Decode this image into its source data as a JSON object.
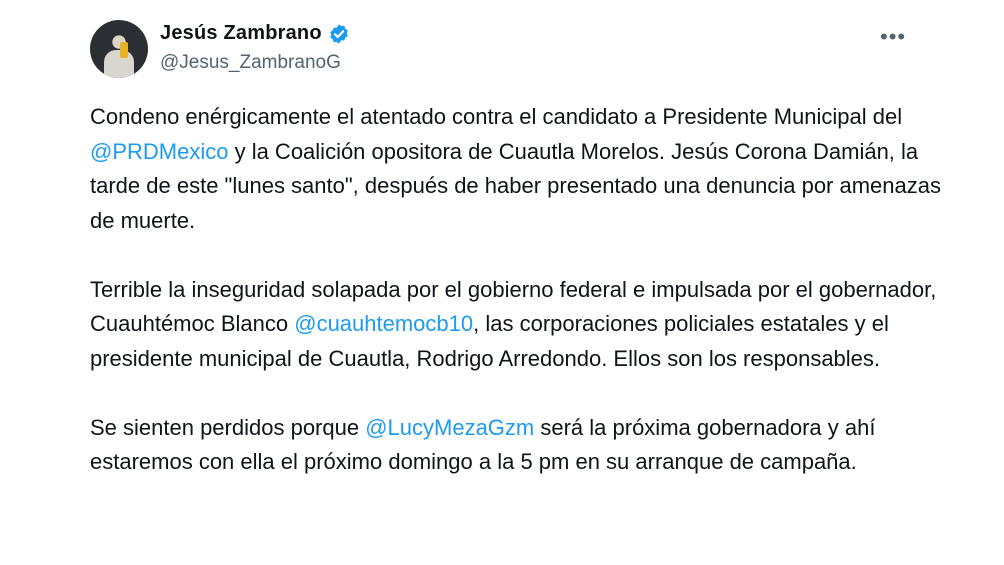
{
  "author": {
    "display_name": "Jesús Zambrano",
    "handle": "@Jesus_ZambranoG",
    "verified": true,
    "verified_color": "#1d9bf0"
  },
  "menu_icon": "more-horizontal-icon",
  "colors": {
    "text": "#0f1419",
    "secondary": "#536471",
    "mention": "#1d9bf0"
  },
  "tweet": {
    "p1": {
      "t1": "Condeno enérgicamente el atentado contra el candidato a Presidente Municipal del ",
      "m1": "@PRDMexico",
      "t2": " y la Coalición opositora de Cuautla Morelos. Jesús Corona Damián, la tarde de este \"lunes santo\", después de haber presentado una denuncia por amenazas de muerte."
    },
    "p2": {
      "t1": "Terrible la inseguridad solapada por el gobierno federal e impulsada por el gobernador, Cuauhtémoc Blanco ",
      "m1": "@cuauhtemocb10",
      "t2": ", las corporaciones policiales estatales y el presidente municipal de Cuautla, Rodrigo Arredondo. Ellos son los responsables."
    },
    "p3": {
      "t1": "Se sienten perdidos porque ",
      "m1": "@LucyMezaGzm",
      "t2": " será la próxima gobernadora y ahí estaremos con ella el próximo domingo a la 5 pm en su arranque de campaña."
    }
  }
}
